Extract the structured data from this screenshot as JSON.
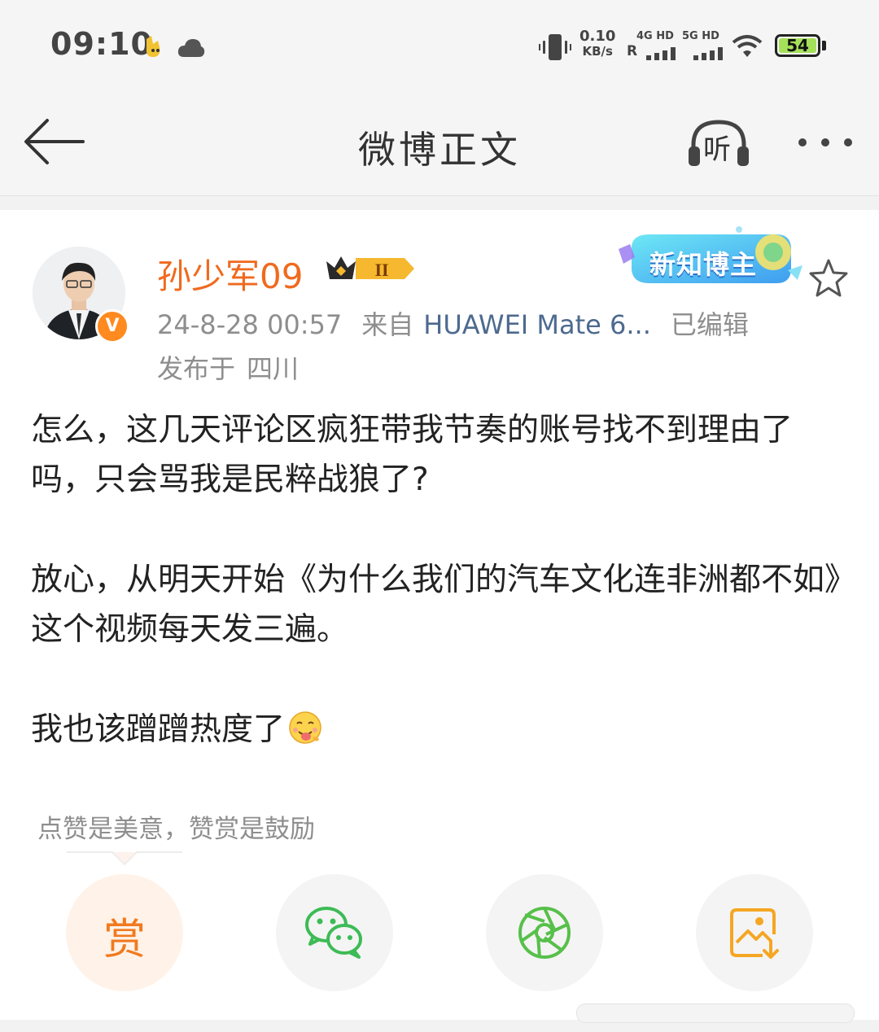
{
  "status_bar": {
    "time": "09:10",
    "speed_value": "0.10",
    "speed_unit": "KB/s",
    "net1_type": "4G HD",
    "net1_extra": "R",
    "net2_type": "5G HD",
    "battery": "54"
  },
  "nav": {
    "title": "微博正文",
    "listen_label": "听"
  },
  "post": {
    "username": "孙少军09",
    "crown_level": "II",
    "verify_badge": "V",
    "badge_text": "新知博主",
    "date": "24-8-28 00:57",
    "from_label": "来自",
    "device": "HUAWEI Mate 6...",
    "edited": "已编辑",
    "location_label": "发布于",
    "location": "四川",
    "paragraphs": [
      "怎么，这几天评论区疯狂带我节奏的账号找不到理由了吗，只会骂我是民粹战狼了?",
      "放心，从明天开始《为什么我们的汽车文化连非洲都不如》这个视频每天发三遍。",
      "我也该蹭蹭热度了"
    ],
    "emoji": "yummy-face",
    "tip": "点赞是美意，赞赏是鼓励",
    "reward_label": "赏"
  },
  "colors": {
    "accent_orange": "#f06a1e",
    "link_blue": "#4d6a8f",
    "wechat_green": "#3dbb56",
    "moments_green": "#57c04a",
    "save_orange": "#f5a623"
  }
}
